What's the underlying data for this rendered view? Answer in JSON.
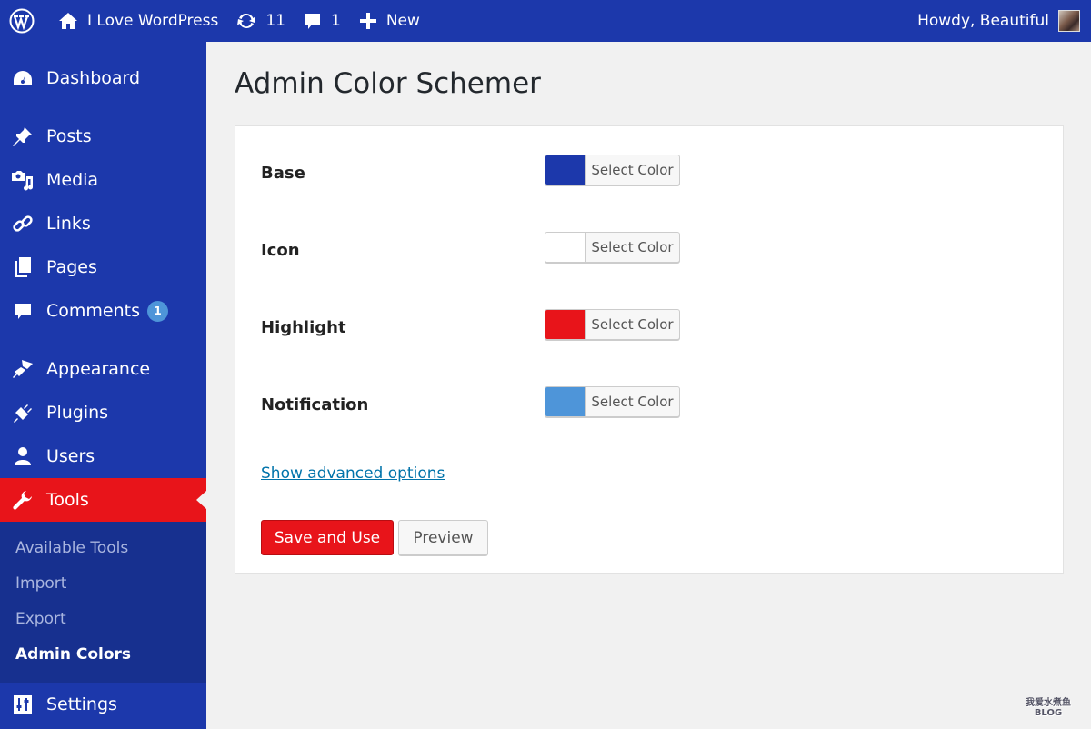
{
  "adminbar": {
    "site_name": "I Love WordPress",
    "updates_count": "11",
    "comments_count": "1",
    "new_label": "New",
    "greeting": "Howdy, Beautiful"
  },
  "sidebar": {
    "items": [
      {
        "label": "Dashboard",
        "icon": "dashboard-icon"
      },
      {
        "label": "Posts",
        "icon": "pushpin-icon"
      },
      {
        "label": "Media",
        "icon": "media-icon"
      },
      {
        "label": "Links",
        "icon": "link-icon"
      },
      {
        "label": "Pages",
        "icon": "pages-icon"
      },
      {
        "label": "Comments",
        "icon": "comment-icon",
        "badge": "1"
      },
      {
        "label": "Appearance",
        "icon": "paintbrush-icon"
      },
      {
        "label": "Plugins",
        "icon": "plugin-icon"
      },
      {
        "label": "Users",
        "icon": "user-icon"
      },
      {
        "label": "Tools",
        "icon": "wrench-icon",
        "active": true
      },
      {
        "label": "Settings",
        "icon": "settings-icon"
      }
    ],
    "submenu": [
      {
        "label": "Available Tools"
      },
      {
        "label": "Import"
      },
      {
        "label": "Export"
      },
      {
        "label": "Admin Colors",
        "current": true
      }
    ]
  },
  "main": {
    "title": "Admin Color Schemer",
    "fields": [
      {
        "label": "Base",
        "button_label": "Select Color",
        "color": "#1c38ab"
      },
      {
        "label": "Icon",
        "button_label": "Select Color",
        "color": "#ffffff"
      },
      {
        "label": "Highlight",
        "button_label": "Select Color",
        "color": "#e8141a"
      },
      {
        "label": "Notification",
        "button_label": "Select Color",
        "color": "#4e95d9"
      }
    ],
    "advanced_link": "Show advanced options",
    "save_label": "Save and Use",
    "preview_label": "Preview"
  },
  "watermark": {
    "line1": "我爱水煮鱼",
    "line2": "BLOG"
  },
  "colors": {
    "base": "#1c38ab",
    "highlight": "#e8141a",
    "notification": "#4e95d9",
    "submenu_bg": "#17308f"
  }
}
